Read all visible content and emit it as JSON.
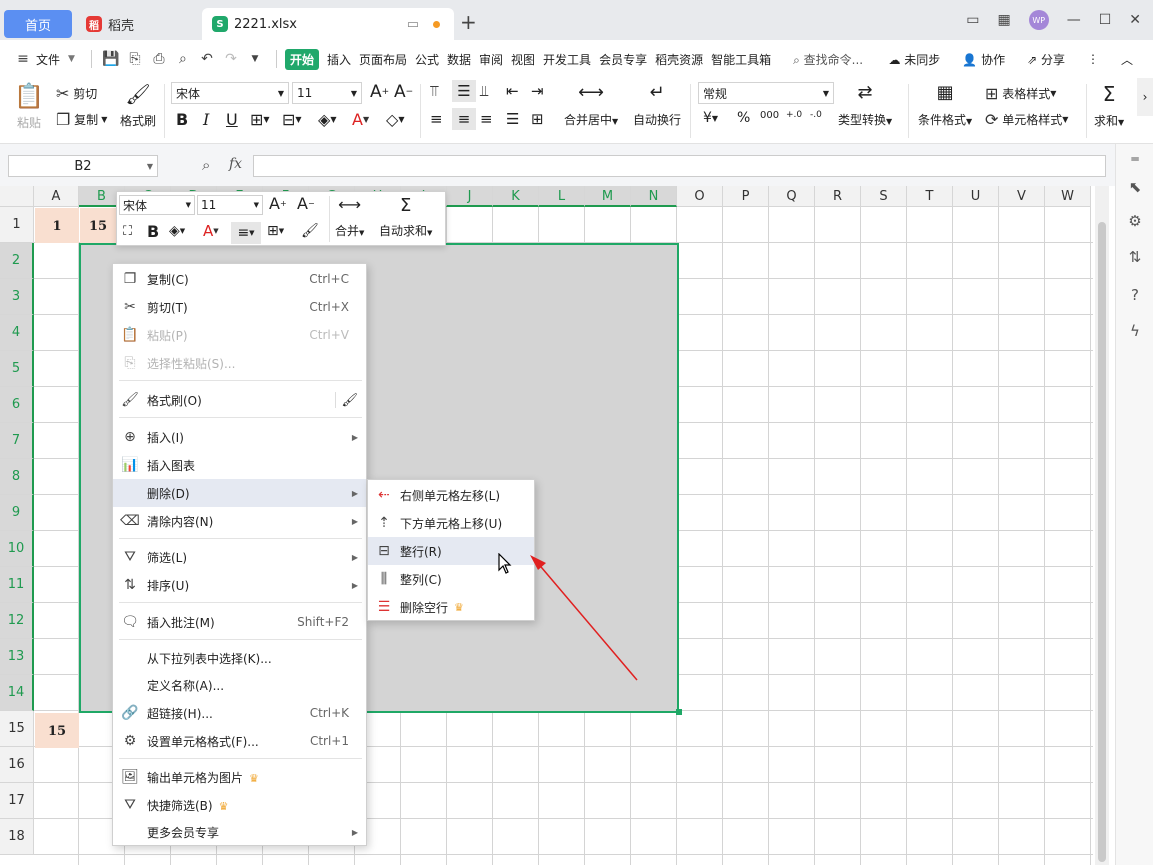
{
  "tabs": [
    {
      "label": "首页"
    },
    {
      "label": "稻壳"
    },
    {
      "label": "2221.xlsx"
    }
  ],
  "menubar": {
    "file": "文件",
    "items": [
      "开始",
      "插入",
      "页面布局",
      "公式",
      "数据",
      "审阅",
      "视图",
      "开发工具",
      "会员专享",
      "稻壳资源",
      "智能工具箱"
    ],
    "search_placeholder": "查找命令...",
    "unsync": "未同步",
    "collab": "协作",
    "share": "分享"
  },
  "ribbon": {
    "paste": "粘贴",
    "cut": "剪切",
    "copy": "复制",
    "format_painter": "格式刷",
    "font_name": "宋体",
    "font_size": "11",
    "merge_center": "合并居中",
    "wrap": "自动换行",
    "number_format": "常规",
    "convert": "类型转换",
    "cond_format": "条件格式",
    "table_style": "表格样式",
    "cell_style": "单元格样式",
    "sum": "求和"
  },
  "formula_bar": {
    "name_box": "B2",
    "fx": "fx"
  },
  "columns": [
    "A",
    "B",
    "C",
    "D",
    "E",
    "F",
    "G",
    "H",
    "I",
    "J",
    "K",
    "L",
    "M",
    "N",
    "O",
    "P",
    "Q",
    "R",
    "S",
    "T",
    "U",
    "V",
    "W"
  ],
  "rows": [
    "1",
    "2",
    "3",
    "4",
    "5",
    "6",
    "7",
    "8",
    "9",
    "10",
    "11",
    "12",
    "13",
    "14",
    "15",
    "16",
    "17",
    "18"
  ],
  "cells": {
    "A1": "1",
    "B1": "15",
    "A15": "15"
  },
  "mini_toolbar": {
    "font_name": "宋体",
    "font_size": "11",
    "merge": "合并",
    "autosum": "自动求和"
  },
  "context_menu": {
    "items": [
      {
        "label": "复制(C)",
        "shortcut": "Ctrl+C",
        "icon": "copy-icon"
      },
      {
        "label": "剪切(T)",
        "shortcut": "Ctrl+X",
        "icon": "scissors-icon"
      },
      {
        "label": "粘贴(P)",
        "shortcut": "Ctrl+V",
        "icon": "paste-icon"
      },
      {
        "label": "选择性粘贴(S)...",
        "shortcut": "",
        "icon": "paste-special-icon"
      },
      {
        "label": "格式刷(O)",
        "shortcut": "",
        "icon": "format-painter-icon"
      },
      {
        "label": "插入(I)",
        "shortcut": "",
        "icon": "insert-row-icon"
      },
      {
        "label": "插入图表",
        "shortcut": "",
        "icon": "chart-icon"
      },
      {
        "label": "删除(D)",
        "shortcut": "",
        "icon": ""
      },
      {
        "label": "清除内容(N)",
        "shortcut": "",
        "icon": "eraser-icon"
      },
      {
        "label": "筛选(L)",
        "shortcut": "",
        "icon": "filter-icon"
      },
      {
        "label": "排序(U)",
        "shortcut": "",
        "icon": "sort-icon"
      },
      {
        "label": "插入批注(M)",
        "shortcut": "Shift+F2",
        "icon": "comment-icon"
      },
      {
        "label": "从下拉列表中选择(K)...",
        "shortcut": "",
        "icon": ""
      },
      {
        "label": "定义名称(A)...",
        "shortcut": "",
        "icon": ""
      },
      {
        "label": "超链接(H)...",
        "shortcut": "Ctrl+K",
        "icon": "link-icon"
      },
      {
        "label": "设置单元格格式(F)...",
        "shortcut": "Ctrl+1",
        "icon": "cell-format-icon"
      },
      {
        "label": "输出单元格为图片",
        "shortcut": "",
        "icon": "image-icon"
      },
      {
        "label": "快捷筛选(B)",
        "shortcut": "",
        "icon": "quick-filter-icon"
      },
      {
        "label": "更多会员专享",
        "shortcut": "",
        "icon": ""
      }
    ]
  },
  "submenu": {
    "items": [
      {
        "label": "右侧单元格左移(L)",
        "icon": "shift-left-icon"
      },
      {
        "label": "下方单元格上移(U)",
        "icon": "shift-up-icon"
      },
      {
        "label": "整行(R)",
        "icon": "delete-row-icon"
      },
      {
        "label": "整列(C)",
        "icon": "delete-column-icon"
      },
      {
        "label": "删除空行",
        "icon": "delete-empty-rows-icon"
      }
    ]
  },
  "colors": {
    "accent_green": "#1fa866",
    "tab_blue": "#5b8ff2",
    "annotation_red": "#e02020",
    "header_fill": "#f9dfd0"
  }
}
